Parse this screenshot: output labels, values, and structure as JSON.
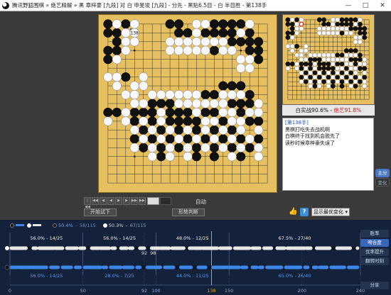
{
  "window": {
    "title": "腾讯野狐围棋 » 绝艺精解 » 黑 章梓豪 [九段] 对 白 申旻埈 [九段] - 分先 - 黑贴6.5目 - 白 半目胜 - 第138手",
    "min": "—",
    "max": "□",
    "close": "✕"
  },
  "board": {
    "size": 19,
    "last_move_label": "138",
    "last_move": [
      3,
      1
    ],
    "black": [
      [
        0,
        0
      ],
      [
        2,
        0
      ],
      [
        7,
        0
      ],
      [
        8,
        0
      ],
      [
        12,
        0
      ],
      [
        13,
        0
      ],
      [
        14,
        0
      ],
      [
        15,
        0
      ],
      [
        0,
        1
      ],
      [
        1,
        1
      ],
      [
        8,
        1
      ],
      [
        9,
        1
      ],
      [
        11,
        1
      ],
      [
        12,
        1
      ],
      [
        13,
        1
      ],
      [
        14,
        1
      ],
      [
        16,
        1
      ],
      [
        1,
        2
      ],
      [
        14,
        2
      ],
      [
        15,
        2
      ],
      [
        16,
        2
      ],
      [
        17,
        2
      ],
      [
        0,
        3
      ],
      [
        1,
        3
      ],
      [
        12,
        3
      ],
      [
        16,
        3
      ],
      [
        17,
        3
      ],
      [
        0,
        4
      ],
      [
        17,
        4
      ],
      [
        2,
        6
      ],
      [
        13,
        7
      ],
      [
        14,
        7
      ],
      [
        15,
        7
      ],
      [
        11,
        8
      ],
      [
        12,
        8
      ],
      [
        16,
        8
      ],
      [
        5,
        9
      ],
      [
        6,
        9
      ],
      [
        7,
        9
      ],
      [
        14,
        9
      ],
      [
        15,
        9
      ],
      [
        16,
        9
      ],
      [
        0,
        10
      ],
      [
        1,
        10
      ],
      [
        3,
        10
      ],
      [
        4,
        10
      ],
      [
        5,
        10
      ],
      [
        7,
        10
      ],
      [
        8,
        10
      ],
      [
        9,
        10
      ],
      [
        11,
        10
      ],
      [
        12,
        10
      ],
      [
        15,
        10
      ],
      [
        3,
        11
      ],
      [
        5,
        11
      ],
      [
        7,
        11
      ],
      [
        8,
        11
      ],
      [
        9,
        11
      ],
      [
        10,
        11
      ],
      [
        13,
        11
      ],
      [
        16,
        11
      ],
      [
        17,
        11
      ],
      [
        4,
        12
      ],
      [
        6,
        12
      ],
      [
        8,
        12
      ],
      [
        10,
        12
      ],
      [
        12,
        12
      ],
      [
        14,
        12
      ],
      [
        3,
        13
      ],
      [
        5,
        13
      ],
      [
        7,
        13
      ],
      [
        9,
        13
      ],
      [
        11,
        13
      ],
      [
        13,
        13
      ],
      [
        15,
        13
      ],
      [
        17,
        13
      ],
      [
        4,
        14
      ],
      [
        6,
        14
      ],
      [
        8,
        14
      ],
      [
        10,
        14
      ],
      [
        12,
        14
      ],
      [
        14,
        14
      ],
      [
        16,
        14
      ],
      [
        6,
        15
      ],
      [
        10,
        15
      ],
      [
        12,
        15
      ],
      [
        15,
        15
      ]
    ],
    "white": [
      [
        1,
        0
      ],
      [
        3,
        0
      ],
      [
        10,
        0
      ],
      [
        11,
        0
      ],
      [
        16,
        0
      ],
      [
        2,
        1
      ],
      [
        3,
        1
      ],
      [
        10,
        1
      ],
      [
        15,
        1
      ],
      [
        2,
        2
      ],
      [
        3,
        2
      ],
      [
        7,
        2
      ],
      [
        8,
        2
      ],
      [
        9,
        2
      ],
      [
        10,
        2
      ],
      [
        11,
        2
      ],
      [
        12,
        2
      ],
      [
        13,
        2
      ],
      [
        2,
        3
      ],
      [
        7,
        3
      ],
      [
        8,
        3
      ],
      [
        9,
        3
      ],
      [
        10,
        3
      ],
      [
        11,
        3
      ],
      [
        13,
        3
      ],
      [
        14,
        3
      ],
      [
        1,
        4
      ],
      [
        15,
        4
      ],
      [
        16,
        4
      ],
      [
        15,
        5
      ],
      [
        16,
        5
      ],
      [
        0,
        6
      ],
      [
        1,
        6
      ],
      [
        4,
        6
      ],
      [
        1,
        7
      ],
      [
        3,
        7
      ],
      [
        4,
        7
      ],
      [
        2,
        8
      ],
      [
        3,
        8
      ],
      [
        5,
        8
      ],
      [
        6,
        8
      ],
      [
        7,
        8
      ],
      [
        8,
        8
      ],
      [
        9,
        8
      ],
      [
        10,
        8
      ],
      [
        13,
        8
      ],
      [
        14,
        8
      ],
      [
        15,
        8
      ],
      [
        3,
        9
      ],
      [
        4,
        9
      ],
      [
        8,
        9
      ],
      [
        9,
        9
      ],
      [
        10,
        9
      ],
      [
        11,
        9
      ],
      [
        12,
        9
      ],
      [
        13,
        9
      ],
      [
        17,
        9
      ],
      [
        2,
        10
      ],
      [
        6,
        10
      ],
      [
        10,
        10
      ],
      [
        13,
        10
      ],
      [
        14,
        10
      ],
      [
        16,
        10
      ],
      [
        17,
        10
      ],
      [
        0,
        11
      ],
      [
        2,
        11
      ],
      [
        4,
        11
      ],
      [
        6,
        11
      ],
      [
        11,
        11
      ],
      [
        12,
        11
      ],
      [
        14,
        11
      ],
      [
        15,
        11
      ],
      [
        3,
        12
      ],
      [
        5,
        12
      ],
      [
        7,
        12
      ],
      [
        9,
        12
      ],
      [
        11,
        12
      ],
      [
        13,
        12
      ],
      [
        15,
        12
      ],
      [
        17,
        12
      ],
      [
        4,
        13
      ],
      [
        6,
        13
      ],
      [
        8,
        13
      ],
      [
        10,
        13
      ],
      [
        12,
        13
      ],
      [
        14,
        13
      ],
      [
        16,
        13
      ],
      [
        3,
        14
      ],
      [
        5,
        14
      ],
      [
        7,
        14
      ],
      [
        9,
        14
      ],
      [
        11,
        14
      ],
      [
        13,
        14
      ],
      [
        15,
        14
      ],
      [
        17,
        14
      ],
      [
        5,
        15
      ],
      [
        7,
        15
      ],
      [
        9,
        15
      ],
      [
        14,
        15
      ],
      [
        17,
        15
      ]
    ]
  },
  "minimap": {
    "caption_main": "白实战90.6% - ",
    "caption_red": "绝艺91.8%"
  },
  "comment": {
    "move_label": "[第138手]",
    "lines": [
      "黑棋打吃失去战机啊",
      "白棋终于找到机会脱先了",
      "读秒时候章梓豪失误了"
    ]
  },
  "sidetabs": {
    "main": "主分",
    "branch": "变化"
  },
  "controls": {
    "buttons": [
      "|◀◀",
      "◀◀",
      "◀",
      "◀",
      "▶",
      "▶",
      "▶▶",
      "▶▶|"
    ],
    "progress_end": "···",
    "auto": "自动",
    "trial": "开始试下",
    "judge": "形势判断"
  },
  "toolbar": {
    "select_value": "显示最优变化",
    "select_arrow": "▾"
  },
  "legend": {
    "black_pct": "50.4%",
    "black_count": "58/115",
    "white_pct": "50.3%",
    "white_count": "67/115"
  },
  "analysis_tabs": [
    "胜率",
    "吻合度",
    "优率提升",
    "翻转时刻"
  ],
  "share": "分享",
  "chart_data": {
    "type": "line",
    "x_ticks": [
      0,
      50,
      92,
      100,
      138,
      150,
      200,
      240
    ],
    "x_range": [
      0,
      240
    ],
    "current_move": 138,
    "marker_labels": [
      "92",
      "98"
    ],
    "white_segments": [
      {
        "pct": "56.0%",
        "count": "14/25"
      },
      {
        "pct": "56.0%",
        "count": "14/25"
      },
      {
        "pct": "48.0%",
        "count": "12/25"
      },
      {
        "pct": "67.5%",
        "count": "27/40"
      }
    ],
    "black_segments": [
      {
        "pct": "56.0%",
        "count": "14/25"
      },
      {
        "pct": "28.0%",
        "count": "7/25"
      },
      {
        "pct": "44.0%",
        "count": "11/25"
      },
      {
        "pct": "65.0%",
        "count": "26/40"
      }
    ],
    "colors": {
      "white": "#e8e8e8",
      "black": "#3c86e8",
      "current": "#e0a030",
      "background": "#14213a"
    }
  }
}
